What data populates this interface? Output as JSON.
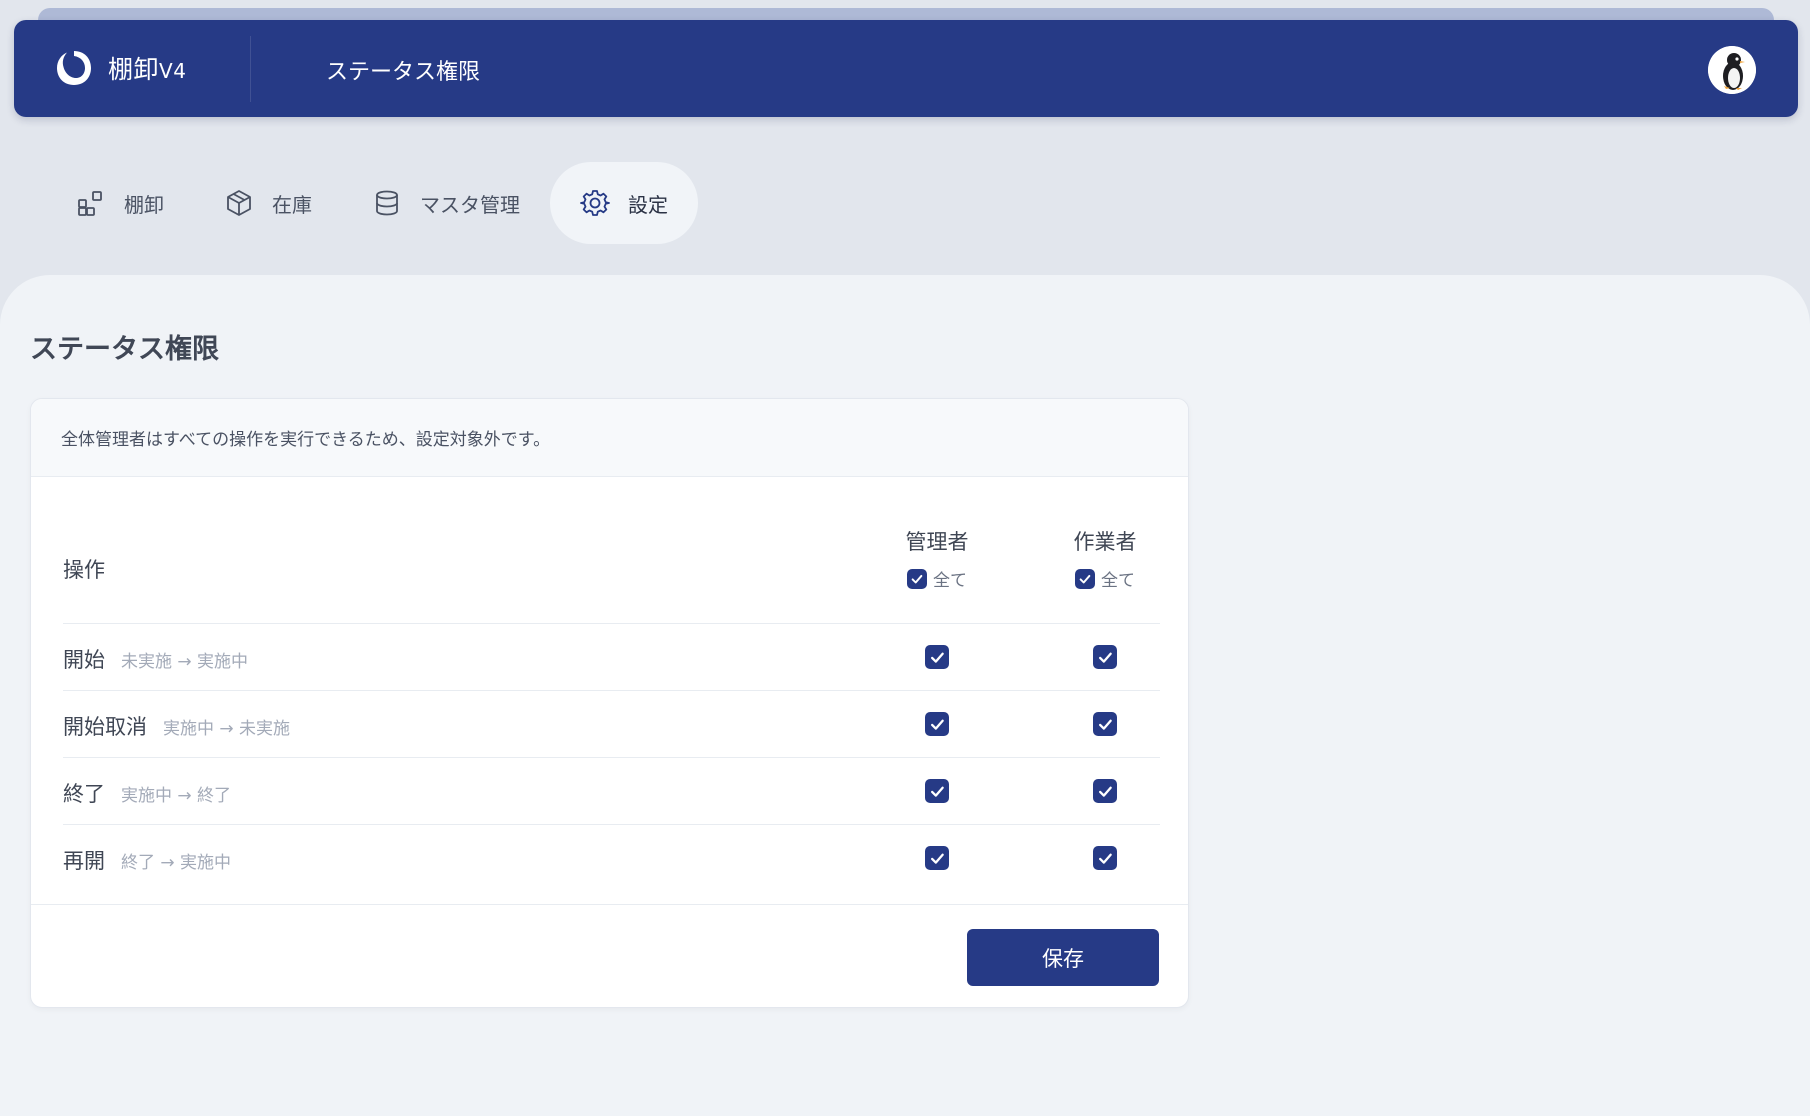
{
  "header": {
    "app_name": "棚卸",
    "app_version": "V4",
    "title": "ステータス権限"
  },
  "nav": {
    "items": [
      {
        "label": "棚卸",
        "icon": "blocks-icon"
      },
      {
        "label": "在庫",
        "icon": "box-icon"
      },
      {
        "label": "マスタ管理",
        "icon": "database-icon"
      },
      {
        "label": "設定",
        "icon": "gear-icon",
        "active": true
      }
    ]
  },
  "page": {
    "title": "ステータス権限",
    "notice": "全体管理者はすべての操作を実行できるため、設定対象外です。"
  },
  "table": {
    "op_header": "操作",
    "columns": [
      {
        "role": "管理者",
        "all_label": "全て",
        "all_checked": true
      },
      {
        "role": "作業者",
        "all_label": "全て",
        "all_checked": true
      }
    ],
    "rows": [
      {
        "op": "開始",
        "transition": "未実施 → 実施中",
        "admin": true,
        "worker": true
      },
      {
        "op": "開始取消",
        "transition": "実施中 → 未実施",
        "admin": true,
        "worker": true
      },
      {
        "op": "終了",
        "transition": "実施中 → 終了",
        "admin": true,
        "worker": true
      },
      {
        "op": "再開",
        "transition": "終了 → 実施中",
        "admin": true,
        "worker": true
      }
    ]
  },
  "footer": {
    "save_label": "保存"
  },
  "colors": {
    "brand": "#263a86",
    "background": "#e2e6ed",
    "content_bg": "#f0f3f7"
  }
}
